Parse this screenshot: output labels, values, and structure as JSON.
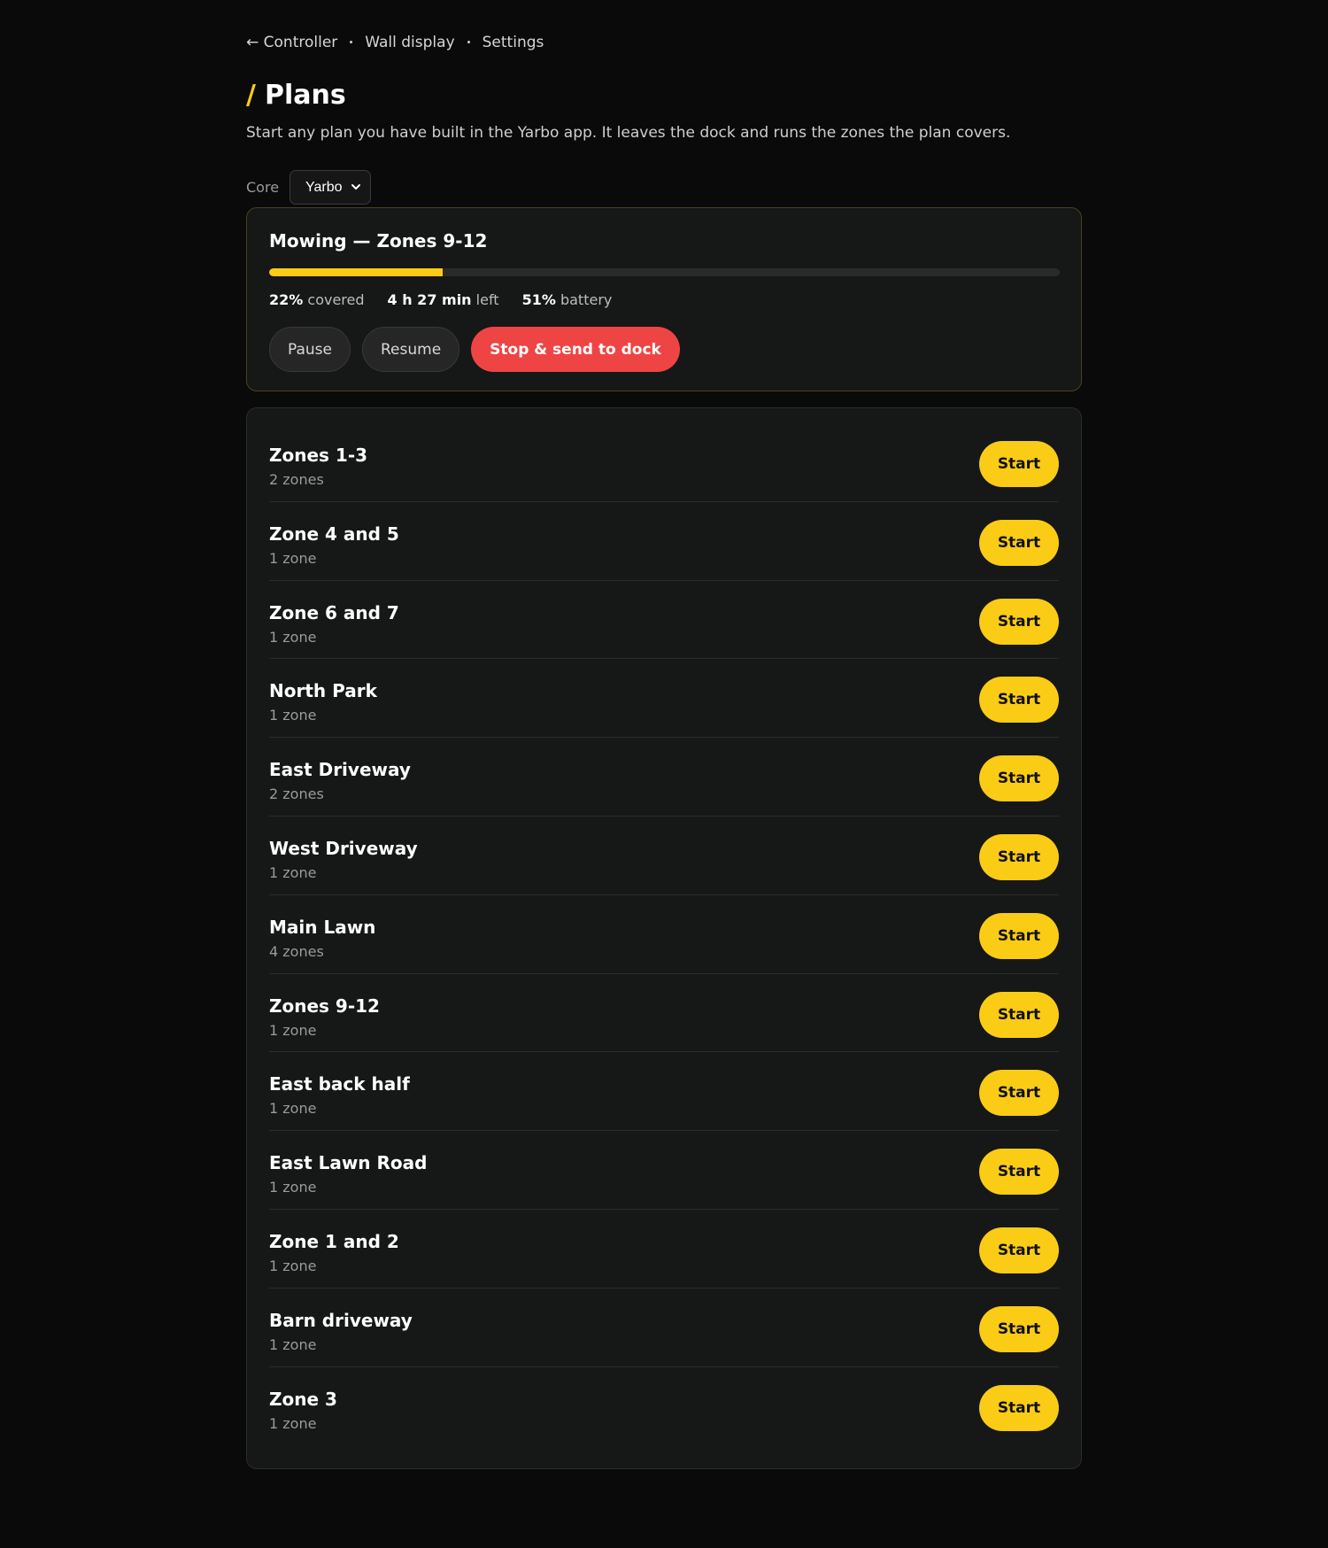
{
  "nav": {
    "back_label": "← Controller",
    "links": [
      "Wall display",
      "Settings"
    ]
  },
  "page": {
    "title_prefix": "/",
    "title": "Plans",
    "subtitle": "Start any plan you have built in the Yarbo app. It leaves the dock and runs the zones the plan covers."
  },
  "core": {
    "label": "Core",
    "selected": "Yarbo"
  },
  "status": {
    "title": "Mowing — Zones 9-12",
    "progress_fraction": 0.22,
    "covered_value": "22%",
    "covered_label": "covered",
    "time_value": "4 h 27 min",
    "time_label": "left",
    "battery_value": "51%",
    "battery_label": "battery",
    "pause_label": "Pause",
    "resume_label": "Resume",
    "stop_label": "Stop & send to dock"
  },
  "plans": [
    {
      "name": "Zones 1-3",
      "zones": "2 zones"
    },
    {
      "name": "Zone 4 and 5",
      "zones": "1 zone"
    },
    {
      "name": "Zone 6 and 7",
      "zones": "1 zone"
    },
    {
      "name": "North Park",
      "zones": "1 zone"
    },
    {
      "name": "East Driveway",
      "zones": "2 zones"
    },
    {
      "name": "West Driveway",
      "zones": "1 zone"
    },
    {
      "name": "Main Lawn",
      "zones": "4 zones"
    },
    {
      "name": "Zones 9-12",
      "zones": "1 zone"
    },
    {
      "name": "East back half",
      "zones": "1 zone"
    },
    {
      "name": "East Lawn Road",
      "zones": "1 zone"
    },
    {
      "name": "Zone 1 and 2",
      "zones": "1 zone"
    },
    {
      "name": "Barn driveway",
      "zones": "1 zone"
    },
    {
      "name": "Zone 3",
      "zones": "1 zone"
    }
  ],
  "start_label": "Start",
  "colors": {
    "accent": "#facc15",
    "danger": "#ef4444",
    "background": "#0a0a0a",
    "card": "#161717"
  }
}
